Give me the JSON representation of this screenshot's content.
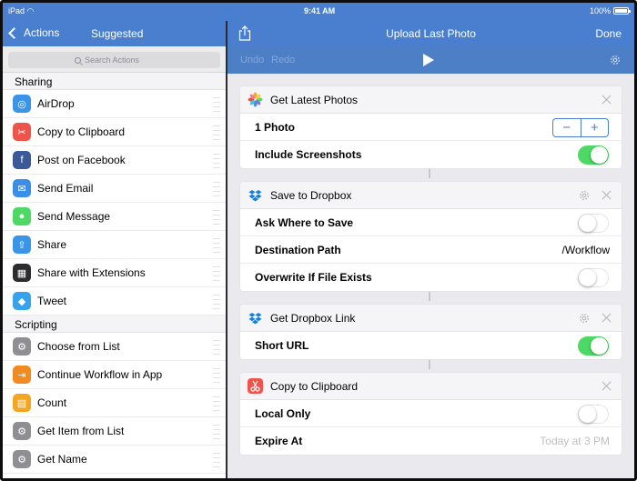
{
  "status_bar": {
    "device": "iPad",
    "time": "9:41 AM",
    "battery": "100%"
  },
  "sidebar": {
    "back_label": "Actions",
    "title": "Suggested",
    "search_placeholder": "Search Actions",
    "sections": [
      {
        "title": "Sharing",
        "items": [
          {
            "label": "AirDrop",
            "icon": "airdrop-icon",
            "color": "#3a94e8"
          },
          {
            "label": "Copy to Clipboard",
            "icon": "scissors-icon",
            "color": "#f0534a"
          },
          {
            "label": "Post on Facebook",
            "icon": "facebook-icon",
            "color": "#3b5998"
          },
          {
            "label": "Send Email",
            "icon": "mail-icon",
            "color": "#3b8ee8"
          },
          {
            "label": "Send Message",
            "icon": "message-icon",
            "color": "#4cd964"
          },
          {
            "label": "Share",
            "icon": "share-icon",
            "color": "#3a94e8"
          },
          {
            "label": "Share with Extensions",
            "icon": "extensions-icon",
            "color": "#2c2c2e"
          },
          {
            "label": "Tweet",
            "icon": "twitter-icon",
            "color": "#36a3ec"
          }
        ]
      },
      {
        "title": "Scripting",
        "items": [
          {
            "label": "Choose from List",
            "icon": "gear-icon",
            "color": "#8e8e93"
          },
          {
            "label": "Continue Workflow in App",
            "icon": "continue-icon",
            "color": "#f28a22"
          },
          {
            "label": "Count",
            "icon": "calculator-icon",
            "color": "#f4a623"
          },
          {
            "label": "Get Item from List",
            "icon": "gear-icon",
            "color": "#8e8e93"
          },
          {
            "label": "Get Name",
            "icon": "gear-icon",
            "color": "#8e8e93"
          }
        ]
      }
    ]
  },
  "editor": {
    "title": "Upload Last Photo",
    "done_label": "Done",
    "undo_label": "Undo",
    "redo_label": "Redo",
    "actions": [
      {
        "title": "Get Latest Photos",
        "params": [
          {
            "label": "1 Photo",
            "control": "stepper",
            "minus": "−",
            "plus": "+"
          },
          {
            "label": "Include Screenshots",
            "control": "toggle",
            "on": true
          }
        ]
      },
      {
        "title": "Save to Dropbox",
        "params": [
          {
            "label": "Ask Where to Save",
            "control": "toggle",
            "on": false
          },
          {
            "label": "Destination Path",
            "control": "text",
            "value": "/Workflow"
          },
          {
            "label": "Overwrite If File Exists",
            "control": "toggle",
            "on": false
          }
        ]
      },
      {
        "title": "Get Dropbox Link",
        "params": [
          {
            "label": "Short URL",
            "control": "toggle",
            "on": true
          }
        ]
      },
      {
        "title": "Copy to Clipboard",
        "params": [
          {
            "label": "Local Only",
            "control": "toggle",
            "on": false
          },
          {
            "label": "Expire At",
            "control": "text",
            "value": "Today at 3 PM",
            "placeholder": true
          }
        ]
      }
    ]
  },
  "colors": {
    "accent": "#4a7fd0",
    "toggle_on": "#4cd964",
    "canvas_bg": "#e9e9ee"
  }
}
